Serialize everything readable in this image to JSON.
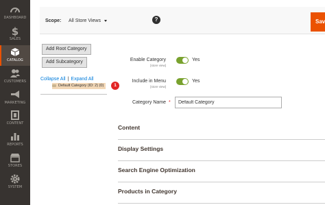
{
  "sidebar": {
    "items": [
      {
        "label": "DASHBOARD",
        "icon": "gauge-icon"
      },
      {
        "label": "SALES",
        "icon": "dollar-icon"
      },
      {
        "label": "CATALOG",
        "icon": "cube-icon"
      },
      {
        "label": "CUSTOMERS",
        "icon": "customers-icon"
      },
      {
        "label": "MARKETING",
        "icon": "megaphone-icon"
      },
      {
        "label": "CONTENT",
        "icon": "content-icon"
      },
      {
        "label": "REPORTS",
        "icon": "bar-chart-icon"
      },
      {
        "label": "STORES",
        "icon": "store-icon"
      },
      {
        "label": "SYSTEM",
        "icon": "gear-icon"
      }
    ],
    "active_label": "CATALOG"
  },
  "scope": {
    "label": "Scope:",
    "selected": "All Store Views"
  },
  "header": {
    "save_label": "Sav"
  },
  "tree": {
    "add_root_label": "Add Root Category",
    "add_sub_label": "Add Subcategory",
    "collapse_label": "Collapse All",
    "separator": "|",
    "expand_label": "Expand All",
    "node_label": "Default Category (ID: 2) (0)",
    "badge": "1"
  },
  "form": {
    "enable": {
      "label": "Enable Category",
      "scope": "[store view]",
      "value": "Yes"
    },
    "menu": {
      "label": "Include in Menu",
      "scope": "[store view]",
      "value": "Yes"
    },
    "name": {
      "label": "Category Name",
      "value": "Default Category"
    }
  },
  "sections": [
    "Content",
    "Display Settings",
    "Search Engine Optimization",
    "Products in Category"
  ],
  "colors": {
    "accent": "#eb5202",
    "sidebar": "#373330",
    "toggle_on": "#79a22e",
    "link": "#007bdb",
    "badge": "#e22626"
  }
}
